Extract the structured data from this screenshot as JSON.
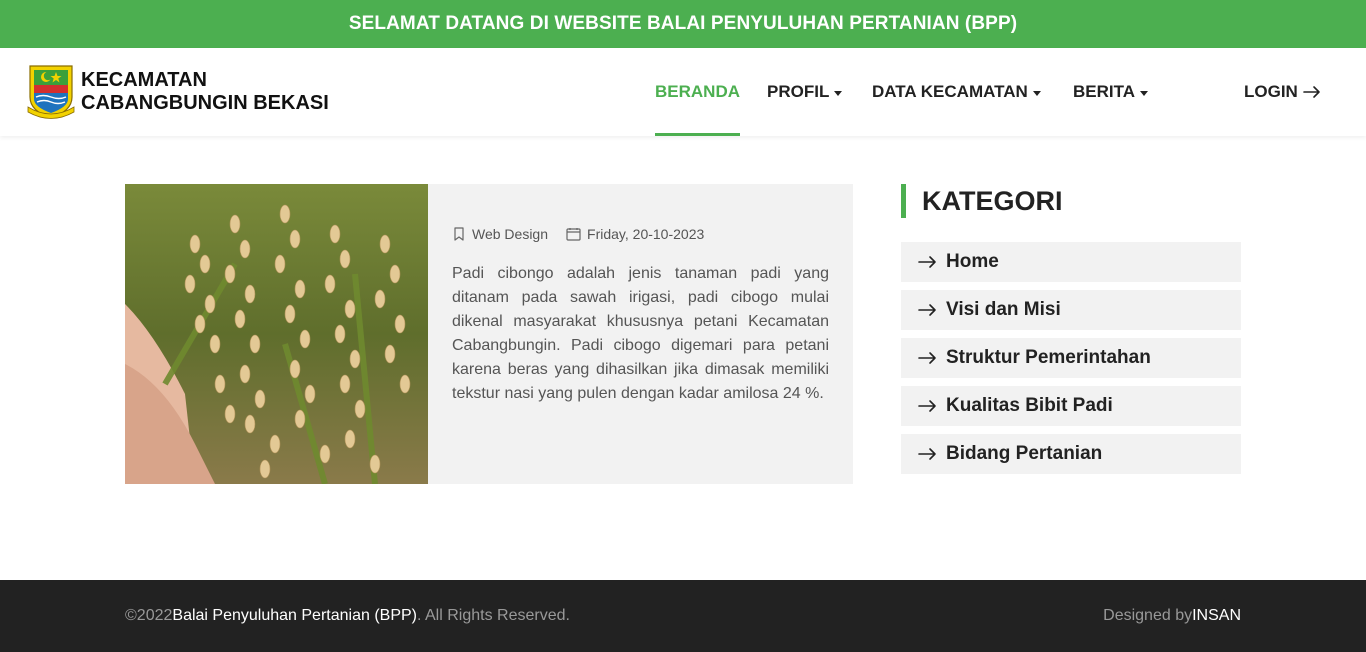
{
  "banner": {
    "text": "SELAMAT DATANG DI WEBSITE BALAI PENYULUHAN PERTANIAN (BPP)"
  },
  "brand": {
    "line1": "KECAMATAN",
    "line2": "CABANGBUNGIN BEKASI",
    "logo_icon": "bekasi-regency-emblem"
  },
  "nav": {
    "items": [
      {
        "label": "BERANDA",
        "active": true,
        "dropdown": false
      },
      {
        "label": "PROFIL",
        "active": false,
        "dropdown": true
      },
      {
        "label": "DATA KECAMATAN",
        "active": false,
        "dropdown": true
      },
      {
        "label": "BERITA",
        "active": false,
        "dropdown": true
      }
    ],
    "login_label": "LOGIN",
    "login_icon": "arrow-right-icon"
  },
  "post": {
    "image_icon": "rice-plant-photo",
    "category": "Web Design",
    "category_icon": "bookmark-icon",
    "date": "Friday, 20-10-2023",
    "date_icon": "calendar-icon",
    "text": "Padi cibongo adalah jenis tanaman padi yang ditanam pada sawah irigasi, padi cibogo mulai dikenal masyarakat khususnya petani Kecamatan Cabangbungin. Padi cibogo digemari para petani karena beras yang dihasilkan jika dimasak memiliki tekstur nasi yang pulen dengan kadar amilosa 24 %."
  },
  "sidebar": {
    "title": "KATEGORI",
    "items": [
      {
        "label": "Home"
      },
      {
        "label": "Visi dan Misi"
      },
      {
        "label": "Struktur Pemerintahan"
      },
      {
        "label": "Kualitas Bibit Padi"
      },
      {
        "label": "Bidang Pertanian"
      }
    ]
  },
  "footer": {
    "copyright_prefix": "©2022 ",
    "org_name": "Balai Penyuluhan Pertanian (BPP)",
    "copyright_suffix": ". All Rights Reserved.",
    "designed_by_prefix": "Designed by ",
    "designer": "INSAN"
  },
  "colors": {
    "accent": "#4caf50",
    "footer_bg": "#222222",
    "card_bg": "#f2f2f2"
  }
}
